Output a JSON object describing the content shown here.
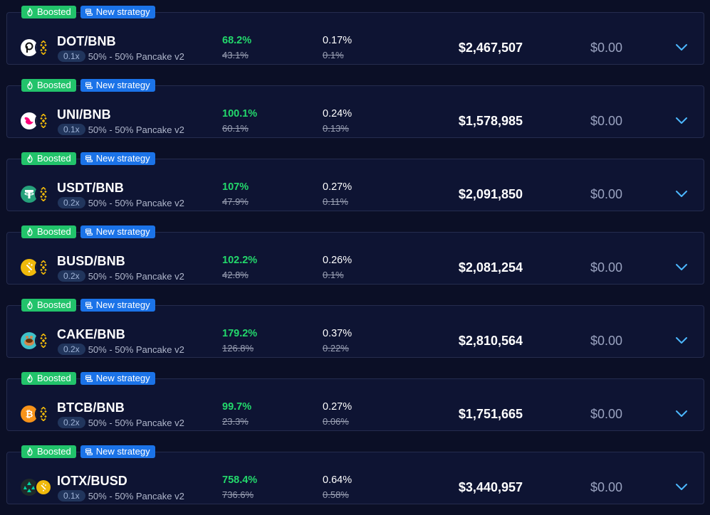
{
  "badges": {
    "boosted": "Boosted",
    "new_strategy": "New strategy"
  },
  "colors": {
    "background": "#0b0f26",
    "card": "#0e1433",
    "apy_green": "#23d96c",
    "boosted_tag": "#22c36b",
    "strategy_tag": "#1b73e8",
    "chevron": "#4db8ff"
  },
  "rows": [
    {
      "pair": "DOT/BNB",
      "leverage": "0.1x",
      "strategy": "50% - 50% Pancake v2",
      "apy": "68.2%",
      "apy_old": "43.1%",
      "daily": "0.17%",
      "daily_old": "0.1%",
      "tvl": "$2,467,507",
      "position": "$0.00",
      "coin1_icon": "polkadot-icon",
      "coin2_icon": "bnb-icon"
    },
    {
      "pair": "UNI/BNB",
      "leverage": "0.1x",
      "strategy": "50% - 50% Pancake v2",
      "apy": "100.1%",
      "apy_old": "60.1%",
      "daily": "0.24%",
      "daily_old": "0.13%",
      "tvl": "$1,578,985",
      "position": "$0.00",
      "coin1_icon": "uniswap-icon",
      "coin2_icon": "bnb-icon"
    },
    {
      "pair": "USDT/BNB",
      "leverage": "0.2x",
      "strategy": "50% - 50% Pancake v2",
      "apy": "107%",
      "apy_old": "47.9%",
      "daily": "0.27%",
      "daily_old": "0.11%",
      "tvl": "$2,091,850",
      "position": "$0.00",
      "coin1_icon": "tether-icon",
      "coin2_icon": "bnb-icon"
    },
    {
      "pair": "BUSD/BNB",
      "leverage": "0.2x",
      "strategy": "50% - 50% Pancake v2",
      "apy": "102.2%",
      "apy_old": "42.8%",
      "daily": "0.26%",
      "daily_old": "0.1%",
      "tvl": "$2,081,254",
      "position": "$0.00",
      "coin1_icon": "busd-icon",
      "coin2_icon": "bnb-icon"
    },
    {
      "pair": "CAKE/BNB",
      "leverage": "0.2x",
      "strategy": "50% - 50% Pancake v2",
      "apy": "179.2%",
      "apy_old": "126.8%",
      "daily": "0.37%",
      "daily_old": "0.22%",
      "tvl": "$2,810,564",
      "position": "$0.00",
      "coin1_icon": "pancake-icon",
      "coin2_icon": "bnb-icon"
    },
    {
      "pair": "BTCB/BNB",
      "leverage": "0.2x",
      "strategy": "50% - 50% Pancake v2",
      "apy": "99.7%",
      "apy_old": "23.3%",
      "daily": "0.27%",
      "daily_old": "0.06%",
      "tvl": "$1,751,665",
      "position": "$0.00",
      "coin1_icon": "bitcoin-icon",
      "coin2_icon": "bnb-icon"
    },
    {
      "pair": "IOTX/BUSD",
      "leverage": "0.1x",
      "strategy": "50% - 50% Pancake v2",
      "apy": "758.4%",
      "apy_old": "736.6%",
      "daily": "0.64%",
      "daily_old": "0.58%",
      "tvl": "$3,440,957",
      "position": "$0.00",
      "coin1_icon": "iotex-icon",
      "coin2_icon": "busd-icon"
    }
  ]
}
